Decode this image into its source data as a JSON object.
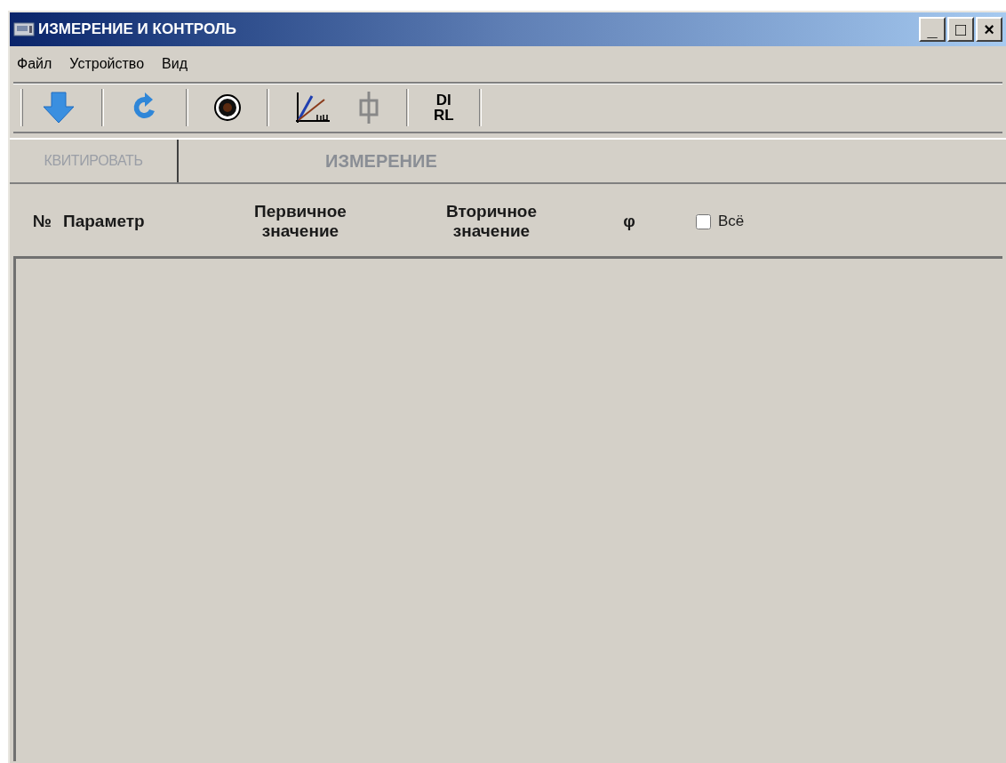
{
  "window": {
    "title": "ИЗМЕРЕНИЕ И КОНТРОЛЬ",
    "controls": [
      "_",
      "□",
      "×"
    ]
  },
  "menu": [
    "Файл",
    "Устройство",
    "Вид"
  ],
  "toolbar": [
    {
      "kind": "download"
    },
    {
      "kind": "sep"
    },
    {
      "kind": "refresh"
    },
    {
      "kind": "sep"
    },
    {
      "kind": "record"
    },
    {
      "kind": "sep"
    },
    {
      "kind": "vector"
    },
    {
      "kind": "phi"
    },
    {
      "kind": "sep"
    },
    {
      "kind": "text",
      "label": "DI\nRL"
    },
    {
      "kind": "sep"
    }
  ],
  "ack_button": {
    "label": "КВИТИРОВАТЬ",
    "disabled": true
  },
  "section_title": "ИЗМЕРЕНИЕ",
  "table": {
    "columns": [
      "№",
      "Параметр",
      "Первичное\nзначение",
      "Вторичное\nзначение",
      "φ"
    ],
    "select_all": {
      "label": "Всё",
      "checked": false
    }
  }
}
